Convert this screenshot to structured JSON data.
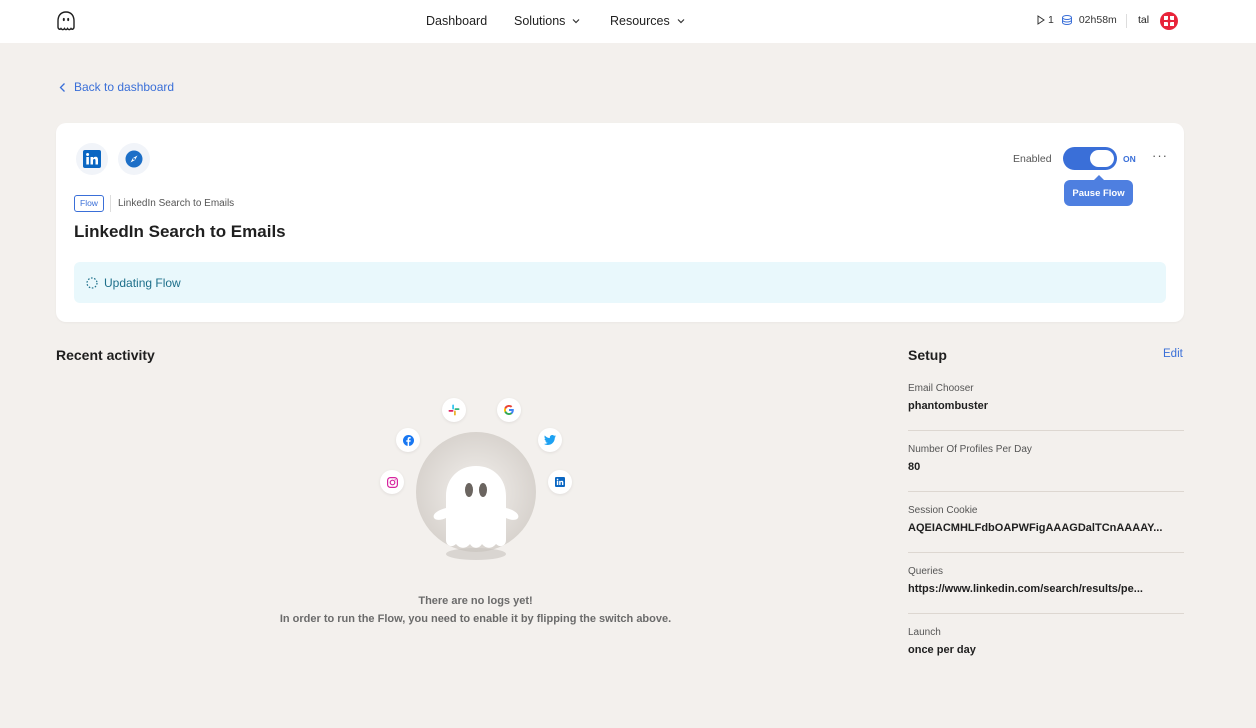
{
  "nav": {
    "items": [
      {
        "label": "Dashboard"
      },
      {
        "label": "Solutions"
      },
      {
        "label": "Resources"
      }
    ],
    "runs_count": "1",
    "time_remaining": "02h58m",
    "user_name": "tal"
  },
  "back_link": "Back to dashboard",
  "flow": {
    "tag": "Flow",
    "breadcrumb": "LinkedIn Search to Emails",
    "title": "LinkedIn Search to Emails",
    "status": "Updating Flow",
    "enabled_label": "Enabled",
    "toggle_state": "ON",
    "tooltip": "Pause Flow",
    "more": "···"
  },
  "recent_activity": {
    "title": "Recent activity",
    "empty_line1": "There are no logs yet!",
    "empty_line2": "In order to run the Flow, you need to enable it by flipping the switch above."
  },
  "setup": {
    "title": "Setup",
    "edit_label": "Edit",
    "items": [
      {
        "label": "Email Chooser",
        "value": "phantombuster"
      },
      {
        "label": "Number Of Profiles Per Day",
        "value": "80"
      },
      {
        "label": "Session Cookie",
        "value": "AQEIACMHLFdbOAPWFigAAAGDalTCnAAAAY..."
      },
      {
        "label": "Queries",
        "value": "https://www.linkedin.com/search/results/pe..."
      },
      {
        "label": "Launch",
        "value": "once per day"
      }
    ]
  },
  "colors": {
    "accent": "#3a6fd8",
    "background": "#f3f0ed",
    "banner": "#e9f8fc",
    "avatar": "#e8243a"
  }
}
